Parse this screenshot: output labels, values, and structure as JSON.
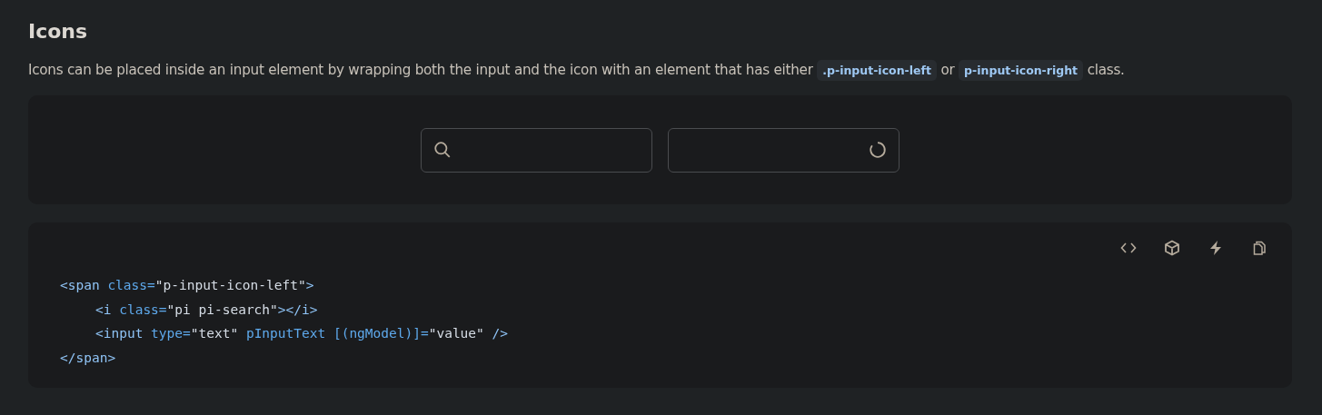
{
  "section": {
    "title": "Icons",
    "description": [
      {
        "kind": "text",
        "text": "Icons can be placed inside an input element by wrapping both the input and the icon with an element that has either "
      },
      {
        "kind": "code",
        "text": ".p-input-icon-left"
      },
      {
        "kind": "text",
        "text": " or "
      },
      {
        "kind": "code",
        "text": "p-input-icon-right"
      },
      {
        "kind": "text",
        "text": " class."
      }
    ]
  },
  "demo": {
    "inputs": [
      {
        "kind": "search"
      },
      {
        "kind": "spinner"
      }
    ]
  },
  "code_block": {
    "toolbar": [
      {
        "kind": "code"
      },
      {
        "kind": "box"
      },
      {
        "kind": "bolt"
      },
      {
        "kind": "copy"
      }
    ],
    "lines": [
      {
        "indented": false,
        "tokens": [
          {
            "kind": "tag",
            "text": "<span"
          },
          {
            "kind": "attr",
            "text": " class="
          },
          {
            "kind": "str",
            "text": "\"p-input-icon-left\""
          },
          {
            "kind": "tag",
            "text": ">"
          }
        ]
      },
      {
        "indented": true,
        "tokens": [
          {
            "kind": "tag",
            "text": "<i"
          },
          {
            "kind": "attr",
            "text": " class="
          },
          {
            "kind": "str",
            "text": "\"pi pi-search\""
          },
          {
            "kind": "tag",
            "text": "></i>"
          }
        ]
      },
      {
        "indented": true,
        "tokens": [
          {
            "kind": "tag",
            "text": "<input"
          },
          {
            "kind": "attr",
            "text": " type="
          },
          {
            "kind": "str",
            "text": "\"text\""
          },
          {
            "kind": "attr",
            "text": " pInputText [(ngModel)]="
          },
          {
            "kind": "str",
            "text": "\"value\""
          },
          {
            "kind": "tag",
            "text": " />"
          }
        ]
      },
      {
        "indented": false,
        "tokens": [
          {
            "kind": "tag",
            "text": "</span>"
          }
        ]
      }
    ]
  }
}
